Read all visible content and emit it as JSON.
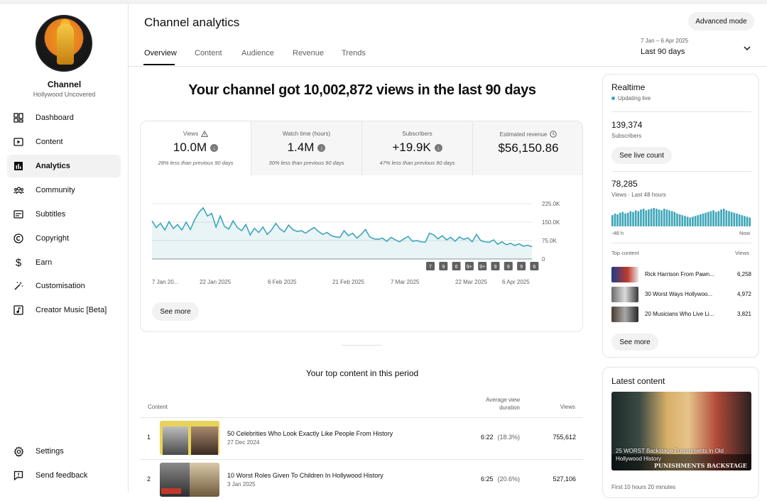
{
  "sidebar": {
    "channel_title": "Channel",
    "channel_name": "Hollywood Uncovered",
    "items": [
      {
        "label": "Dashboard",
        "icon": "dashboard-icon"
      },
      {
        "label": "Content",
        "icon": "content-icon"
      },
      {
        "label": "Analytics",
        "icon": "analytics-icon",
        "active": true
      },
      {
        "label": "Community",
        "icon": "community-icon"
      },
      {
        "label": "Subtitles",
        "icon": "subtitles-icon"
      },
      {
        "label": "Copyright",
        "icon": "copyright-icon"
      },
      {
        "label": "Earn",
        "icon": "dollar-icon"
      },
      {
        "label": "Customisation",
        "icon": "magic-wand-icon"
      },
      {
        "label": "Creator Music [Beta]",
        "icon": "music-icon"
      }
    ],
    "footer": [
      {
        "label": "Settings",
        "icon": "gear-icon"
      },
      {
        "label": "Send feedback",
        "icon": "feedback-icon"
      }
    ]
  },
  "header": {
    "title": "Channel analytics",
    "advanced_mode": "Advanced mode",
    "date_range": "7 Jan – 6 Apr 2025",
    "date_preset": "Last 90 days",
    "tabs": [
      "Overview",
      "Content",
      "Audience",
      "Revenue",
      "Trends"
    ],
    "active_tab": "Overview"
  },
  "overview": {
    "headline": "Your channel got 10,002,872 views in the last 90 days",
    "metrics": [
      {
        "title": "Views",
        "value": "10.0M",
        "note": "28% less than previous 90 days",
        "trend": "down",
        "selected": true
      },
      {
        "title": "Watch time (hours)",
        "value": "1.4M",
        "note": "30% less than previous 90 days",
        "trend": "down"
      },
      {
        "title": "Subscribers",
        "value": "+19.9K",
        "note": "47% less than previous 90 days",
        "trend": "down"
      },
      {
        "title": "Estimated revenue",
        "value": "$56,150.86",
        "note": ""
      }
    ],
    "see_more": "See more"
  },
  "chart_data": {
    "type": "area",
    "x_tick_labels": [
      "7 Jan 20...",
      "22 Jan 2025",
      "6 Feb 2025",
      "21 Feb 2025",
      "7 Mar 2025",
      "22 Mar 2025",
      "6 Apr 2025"
    ],
    "y_tick_labels": [
      "225.0K",
      "150.0K",
      "75.0K",
      "0"
    ],
    "ylim": [
      0,
      225000
    ],
    "grid": true,
    "color": "#3ea6b8",
    "series": [
      {
        "values": [
          155000,
          128000,
          145000,
          118000,
          152000,
          124000,
          140000,
          118000,
          150000,
          120000,
          160000,
          190000,
          208000,
          175000,
          185000,
          130000,
          175000,
          132000,
          122000,
          155000,
          128000,
          115000,
          140000,
          98000,
          125000,
          108000,
          130000,
          100000,
          118000,
          145000,
          122000,
          110000,
          138000,
          120000,
          112000,
          115000,
          105000,
          118000,
          128000,
          112000,
          100000,
          108000,
          95000,
          90000,
          88000,
          115000,
          95000,
          105000,
          85000,
          100000,
          120000,
          90000,
          82000,
          80000,
          85000,
          72000,
          88000,
          78000,
          70000,
          82000,
          92000,
          72000,
          75000,
          70000,
          68000,
          105000,
          98000,
          82000,
          95000,
          78000,
          88000,
          72000,
          90000,
          80000,
          86000,
          70000,
          100000,
          75000,
          70000,
          68000,
          78000,
          60000,
          70000,
          58000,
          64000,
          55000,
          62000,
          52000,
          56000,
          50000
        ]
      }
    ],
    "publish_markers": [
      "7",
      "9",
      "6",
      "9+",
      "9+",
      "9",
      "9",
      "9",
      "6"
    ]
  },
  "top_content": {
    "title": "Your top content in this period",
    "headers": {
      "content": "Content",
      "avg_duration": "Average view duration",
      "views": "Views"
    },
    "rows": [
      {
        "rank": "1",
        "title": "50 Celebrities Who Look Exactly Like People From History",
        "date": "27 Dec 2024",
        "duration": "6:22",
        "pct": "(18.3%)",
        "views": "755,612"
      },
      {
        "rank": "2",
        "title": "10 Worst Roles Given To Children In Hollywood History",
        "date": "3 Jan 2025",
        "duration": "6:25",
        "pct": "(20.6%)",
        "views": "527,106"
      }
    ]
  },
  "realtime": {
    "title": "Realtime",
    "status": "Updating live",
    "subscribers": "139,374",
    "subscribers_label": "Subscribers",
    "live_count_btn": "See live count",
    "views": "78,285",
    "views_label": "Views · Last 48 hours",
    "axis_left": "-48 h",
    "axis_right": "Now",
    "bars": [
      14,
      16,
      15,
      17,
      18,
      16,
      17,
      19,
      18,
      20,
      19,
      21,
      22,
      20,
      21,
      22,
      23,
      22,
      21,
      20,
      22,
      21,
      20,
      19,
      18,
      16,
      15,
      14,
      13,
      12,
      11,
      12,
      13,
      14,
      15,
      16,
      17,
      18,
      19,
      20,
      18,
      19,
      21,
      22,
      20,
      19,
      18,
      17,
      16,
      15,
      14,
      13,
      12,
      11
    ],
    "top_content_label": "Top content",
    "views_col": "Views",
    "items": [
      {
        "title": "Rick Harrison From Pawn...",
        "views": "6,258"
      },
      {
        "title": "30 Worst Ways Hollywoo...",
        "views": "4,972"
      },
      {
        "title": "20 Musicians Who Live Li...",
        "views": "3,821"
      }
    ],
    "see_more": "See more"
  },
  "latest": {
    "title": "Latest content",
    "thumb_caption": "25 WORST Backstage Punishments in Old Hollywood History",
    "thumb_banner": "PUNISHMENTS BACKSTAGE",
    "published": "First 10 hours 20 minutes"
  }
}
